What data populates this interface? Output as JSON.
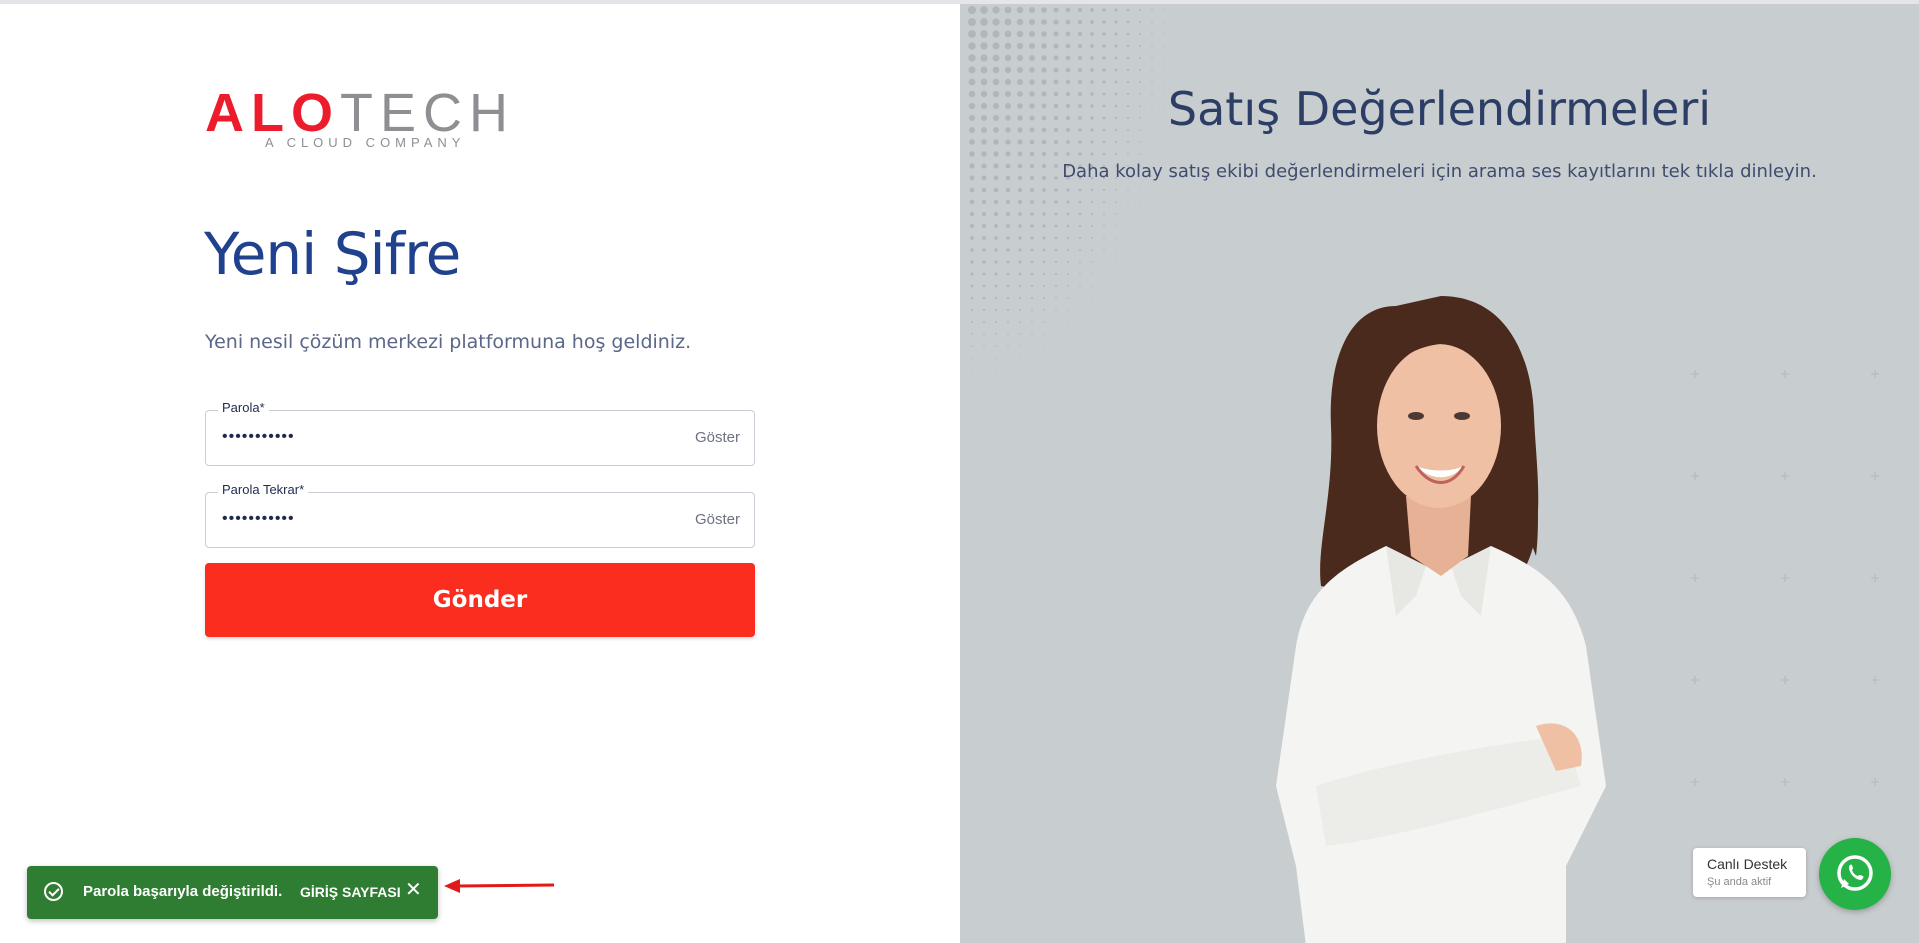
{
  "brand": {
    "logo_alo": "ALO",
    "logo_tech": "TECH",
    "tagline": "A CLOUD COMPANY"
  },
  "form": {
    "title": "Yeni Şifre",
    "subtitle": "Yeni nesil çözüm merkezi platformuna hoş geldiniz.",
    "password": {
      "label": "Parola*",
      "value": "•••••••••••",
      "toggle_label": "Göster"
    },
    "password_repeat": {
      "label": "Parola Tekrar*",
      "value": "•••••••••••",
      "toggle_label": "Göster"
    },
    "submit_label": "Gönder"
  },
  "toast": {
    "message": "Parola başarıyla değiştirildi.",
    "action_label": "GİRİŞ SAYFASI",
    "close_symbol": "✕",
    "icon": "check-circle-icon",
    "color": "#2f7d32"
  },
  "hero": {
    "title": "Satış Değerlendirmeleri",
    "subtitle": "Daha kolay satış ekibi değerlendirmeleri için arama ses kayıtlarını tek tıkla dinleyin."
  },
  "support": {
    "title": "Canlı Destek",
    "status": "Şu anda aktif",
    "icon": "whatsapp-icon"
  },
  "colors": {
    "brand_red": "#ec1c2c",
    "button_red": "#fb2d1f",
    "title_blue": "#20418e",
    "whatsapp_green": "#25b246",
    "annotation_arrow": "#e01919"
  }
}
